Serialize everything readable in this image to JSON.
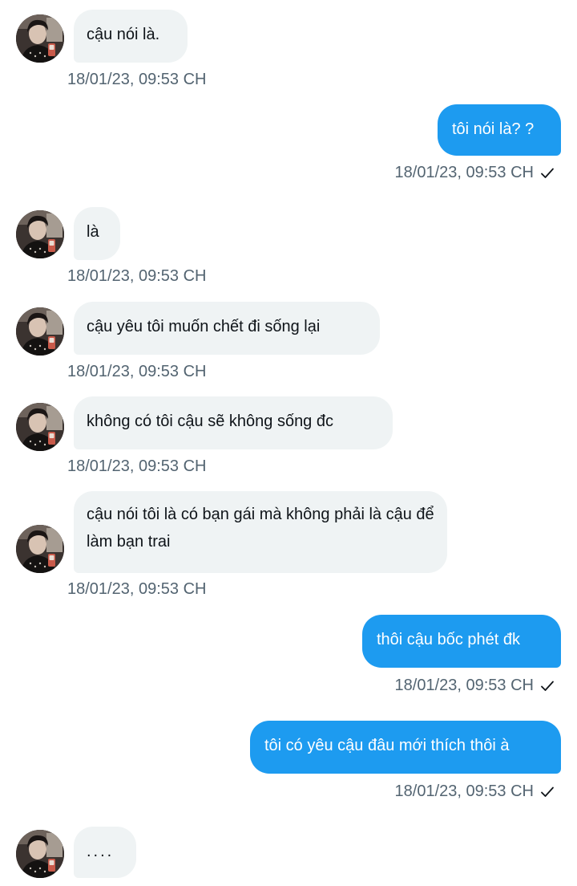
{
  "messages": [
    {
      "direction": "in",
      "text": "cậu nói là.",
      "time": "18/01/23,  09:53 CH"
    },
    {
      "direction": "out",
      "text": "tôi nói là? ?",
      "time": "18/01/23,  09:53 CH",
      "status": "sent-check-icon"
    },
    {
      "direction": "in",
      "text": "là",
      "time": "18/01/23,  09:53 CH"
    },
    {
      "direction": "in",
      "text": "cậu yêu tôi muốn chết đi sống lại",
      "time": "18/01/23,  09:53 CH"
    },
    {
      "direction": "in",
      "text": "không có tôi cậu sẽ không sống đc",
      "time": "18/01/23,  09:53 CH"
    },
    {
      "direction": "in",
      "text": "cậu nói tôi là có bạn gái mà không phải là cậu để làm bạn trai",
      "time": "18/01/23,  09:53 CH"
    },
    {
      "direction": "out",
      "text": "thôi cậu bốc phét đk",
      "time": "18/01/23,  09:53 CH",
      "status": "sent-check-icon"
    },
    {
      "direction": "out",
      "text": "tôi có yêu cậu đâu mới thích thôi à",
      "time": "18/01/23,  09:53 CH",
      "status": "sent-check-icon"
    },
    {
      "direction": "in",
      "text": "....",
      "time": ""
    }
  ],
  "colors": {
    "incoming_bubble": "#eff3f4",
    "outgoing_bubble": "#1d9bf0",
    "timestamp": "#536471",
    "text": "#0f1419"
  }
}
